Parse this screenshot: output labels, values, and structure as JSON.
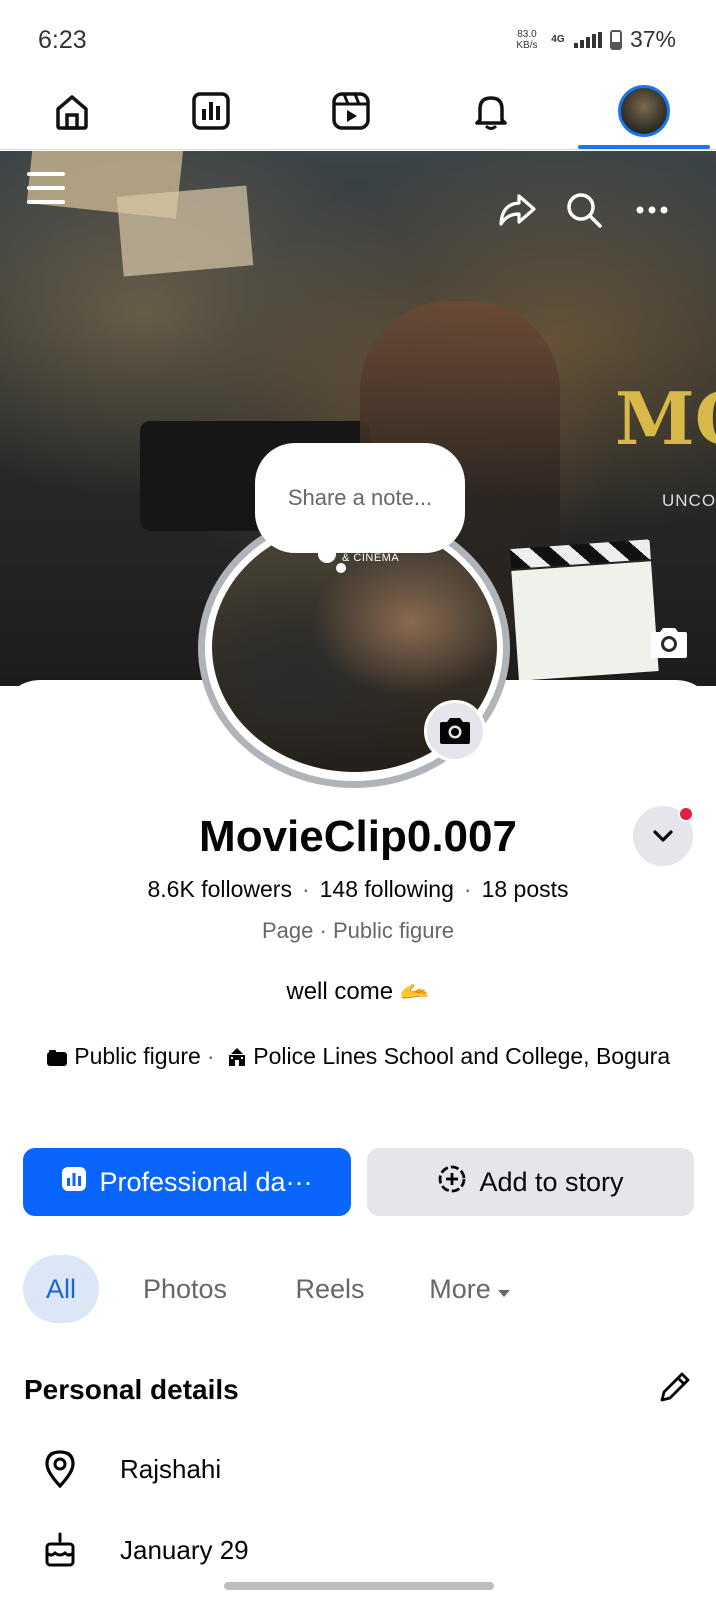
{
  "status_bar": {
    "time": "6:23",
    "speed_value": "83.0",
    "speed_unit": "KB/s",
    "network": "4G",
    "battery": "37%"
  },
  "nav": {
    "items": [
      {
        "name": "home",
        "icon": "home-icon"
      },
      {
        "name": "dashboard",
        "icon": "chart-icon"
      },
      {
        "name": "reels",
        "icon": "video-icon"
      },
      {
        "name": "notifications",
        "icon": "bell-icon"
      },
      {
        "name": "profile",
        "icon": "avatar",
        "active": true
      }
    ],
    "accent": "#1877f2"
  },
  "cover": {
    "title_text": "MOV",
    "subtitle_text": "UNCO",
    "avatar_tag": "& CINEMA",
    "actions": [
      "share-icon",
      "search-icon",
      "more-icon"
    ]
  },
  "note": {
    "placeholder": "Share a note..."
  },
  "profile": {
    "name": "MovieClip0.007",
    "followers": "8.6K followers",
    "following": "148 following",
    "posts": "18 posts",
    "type": "Page",
    "category": "Public figure",
    "bio": "well come 🫴",
    "info_category": "Public figure",
    "info_school": "Police Lines School and College, Bogura"
  },
  "buttons": {
    "professional": "Professional da···",
    "add_story": "Add to story",
    "primary_color": "#0866ff"
  },
  "tabs": {
    "items": [
      "All",
      "Photos",
      "Reels",
      "More"
    ],
    "selected": "All"
  },
  "details": {
    "title": "Personal details",
    "location": "Rajshahi",
    "birthday": "January 29"
  }
}
